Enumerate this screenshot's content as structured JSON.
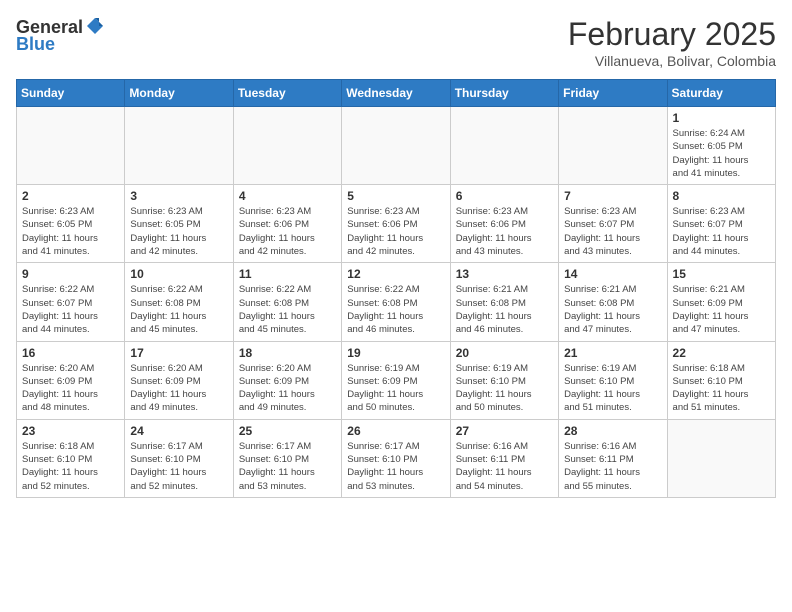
{
  "header": {
    "logo_general": "General",
    "logo_blue": "Blue",
    "month_year": "February 2025",
    "location": "Villanueva, Bolivar, Colombia"
  },
  "weekdays": [
    "Sunday",
    "Monday",
    "Tuesday",
    "Wednesday",
    "Thursday",
    "Friday",
    "Saturday"
  ],
  "weeks": [
    [
      {
        "day": "",
        "info": ""
      },
      {
        "day": "",
        "info": ""
      },
      {
        "day": "",
        "info": ""
      },
      {
        "day": "",
        "info": ""
      },
      {
        "day": "",
        "info": ""
      },
      {
        "day": "",
        "info": ""
      },
      {
        "day": "1",
        "info": "Sunrise: 6:24 AM\nSunset: 6:05 PM\nDaylight: 11 hours\nand 41 minutes."
      }
    ],
    [
      {
        "day": "2",
        "info": "Sunrise: 6:23 AM\nSunset: 6:05 PM\nDaylight: 11 hours\nand 41 minutes."
      },
      {
        "day": "3",
        "info": "Sunrise: 6:23 AM\nSunset: 6:05 PM\nDaylight: 11 hours\nand 42 minutes."
      },
      {
        "day": "4",
        "info": "Sunrise: 6:23 AM\nSunset: 6:06 PM\nDaylight: 11 hours\nand 42 minutes."
      },
      {
        "day": "5",
        "info": "Sunrise: 6:23 AM\nSunset: 6:06 PM\nDaylight: 11 hours\nand 42 minutes."
      },
      {
        "day": "6",
        "info": "Sunrise: 6:23 AM\nSunset: 6:06 PM\nDaylight: 11 hours\nand 43 minutes."
      },
      {
        "day": "7",
        "info": "Sunrise: 6:23 AM\nSunset: 6:07 PM\nDaylight: 11 hours\nand 43 minutes."
      },
      {
        "day": "8",
        "info": "Sunrise: 6:23 AM\nSunset: 6:07 PM\nDaylight: 11 hours\nand 44 minutes."
      }
    ],
    [
      {
        "day": "9",
        "info": "Sunrise: 6:22 AM\nSunset: 6:07 PM\nDaylight: 11 hours\nand 44 minutes."
      },
      {
        "day": "10",
        "info": "Sunrise: 6:22 AM\nSunset: 6:08 PM\nDaylight: 11 hours\nand 45 minutes."
      },
      {
        "day": "11",
        "info": "Sunrise: 6:22 AM\nSunset: 6:08 PM\nDaylight: 11 hours\nand 45 minutes."
      },
      {
        "day": "12",
        "info": "Sunrise: 6:22 AM\nSunset: 6:08 PM\nDaylight: 11 hours\nand 46 minutes."
      },
      {
        "day": "13",
        "info": "Sunrise: 6:21 AM\nSunset: 6:08 PM\nDaylight: 11 hours\nand 46 minutes."
      },
      {
        "day": "14",
        "info": "Sunrise: 6:21 AM\nSunset: 6:08 PM\nDaylight: 11 hours\nand 47 minutes."
      },
      {
        "day": "15",
        "info": "Sunrise: 6:21 AM\nSunset: 6:09 PM\nDaylight: 11 hours\nand 47 minutes."
      }
    ],
    [
      {
        "day": "16",
        "info": "Sunrise: 6:20 AM\nSunset: 6:09 PM\nDaylight: 11 hours\nand 48 minutes."
      },
      {
        "day": "17",
        "info": "Sunrise: 6:20 AM\nSunset: 6:09 PM\nDaylight: 11 hours\nand 49 minutes."
      },
      {
        "day": "18",
        "info": "Sunrise: 6:20 AM\nSunset: 6:09 PM\nDaylight: 11 hours\nand 49 minutes."
      },
      {
        "day": "19",
        "info": "Sunrise: 6:19 AM\nSunset: 6:09 PM\nDaylight: 11 hours\nand 50 minutes."
      },
      {
        "day": "20",
        "info": "Sunrise: 6:19 AM\nSunset: 6:10 PM\nDaylight: 11 hours\nand 50 minutes."
      },
      {
        "day": "21",
        "info": "Sunrise: 6:19 AM\nSunset: 6:10 PM\nDaylight: 11 hours\nand 51 minutes."
      },
      {
        "day": "22",
        "info": "Sunrise: 6:18 AM\nSunset: 6:10 PM\nDaylight: 11 hours\nand 51 minutes."
      }
    ],
    [
      {
        "day": "23",
        "info": "Sunrise: 6:18 AM\nSunset: 6:10 PM\nDaylight: 11 hours\nand 52 minutes."
      },
      {
        "day": "24",
        "info": "Sunrise: 6:17 AM\nSunset: 6:10 PM\nDaylight: 11 hours\nand 52 minutes."
      },
      {
        "day": "25",
        "info": "Sunrise: 6:17 AM\nSunset: 6:10 PM\nDaylight: 11 hours\nand 53 minutes."
      },
      {
        "day": "26",
        "info": "Sunrise: 6:17 AM\nSunset: 6:10 PM\nDaylight: 11 hours\nand 53 minutes."
      },
      {
        "day": "27",
        "info": "Sunrise: 6:16 AM\nSunset: 6:11 PM\nDaylight: 11 hours\nand 54 minutes."
      },
      {
        "day": "28",
        "info": "Sunrise: 6:16 AM\nSunset: 6:11 PM\nDaylight: 11 hours\nand 55 minutes."
      },
      {
        "day": "",
        "info": ""
      }
    ]
  ]
}
